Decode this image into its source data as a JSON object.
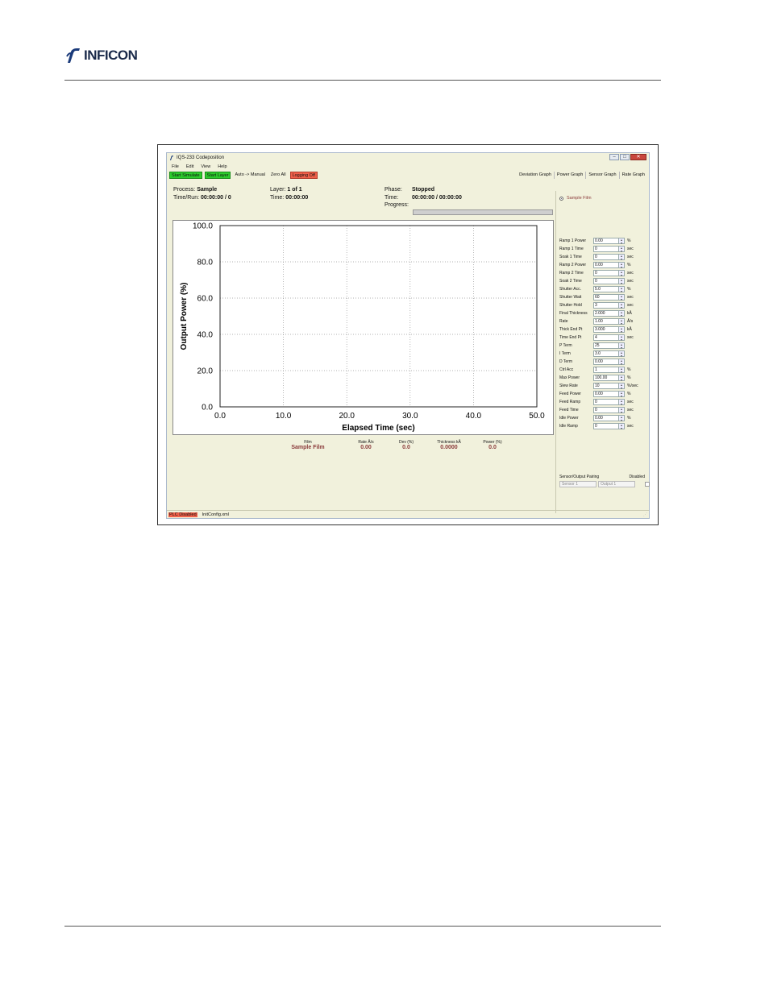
{
  "page": {
    "brand": "INFICON"
  },
  "window": {
    "title": "IQS-233 Codeposition",
    "controls": [
      "–",
      "□",
      "✕"
    ]
  },
  "menu": [
    "File",
    "Edit",
    "View",
    "Help"
  ],
  "toolbar": {
    "buttons": [
      {
        "label": "Start Simulate",
        "style": "green"
      },
      {
        "label": "Start Layer",
        "style": "green"
      },
      {
        "label": "Auto -> Manual",
        "style": "plain"
      },
      {
        "label": "Zero All",
        "style": "plain"
      },
      {
        "label": "Logging Off",
        "style": "red"
      }
    ],
    "graph_tabs": [
      "Deviation Graph",
      "Power Graph",
      "Sensor Graph",
      "Rate Graph"
    ]
  },
  "info": {
    "process_label": "Process:",
    "process_value": "Sample",
    "timerun_label": "Time/Run:",
    "timerun_value": "00:00:00 / 0",
    "layer_label": "Layer:",
    "layer_value": "1 of 1",
    "time_label": "Time:",
    "time_value": "00:00:00",
    "phase_label": "Phase:",
    "phase_value": "Stopped",
    "phase_time_label": "Time:",
    "phase_time_value": "00:00:00 / 00:00:00",
    "progress_label": "Progress:",
    "progress": 0
  },
  "chart_data": {
    "type": "line",
    "xlabel": "Elapsed Time (sec)",
    "ylabel": "Output Power (%)",
    "xlim": [
      0,
      50
    ],
    "ylim": [
      0,
      100
    ],
    "x_ticks": [
      "0.0",
      "10.0",
      "20.0",
      "30.0",
      "40.0",
      "50.0"
    ],
    "y_ticks": [
      "0.0",
      "20.0",
      "40.0",
      "60.0",
      "80.0",
      "100.0"
    ],
    "grid": true,
    "series": []
  },
  "stats": {
    "headers": [
      "Film",
      "Rate Å/s",
      "Dev (%)",
      "Thickness kÅ",
      "Power (%)"
    ],
    "values": [
      "Sample Film",
      "0.00",
      "0.0",
      "0.0000",
      "0.0"
    ]
  },
  "status": {
    "plc": "PLC Disabled",
    "file": "InitConfig.xml"
  },
  "right_panel": {
    "film": "Sample Film",
    "params": [
      {
        "label": "Ramp 1 Power",
        "value": "0.00",
        "unit": "%"
      },
      {
        "label": "Ramp 1 Time",
        "value": "0",
        "unit": "sec"
      },
      {
        "label": "Soak 1 Time",
        "value": "0",
        "unit": "sec"
      },
      {
        "label": "Ramp 2 Power",
        "value": "0.00",
        "unit": "%"
      },
      {
        "label": "Ramp 2 Time",
        "value": "0",
        "unit": "sec"
      },
      {
        "label": "Soak 2 Time",
        "value": "0",
        "unit": "sec"
      },
      {
        "label": "Shutter Acc.",
        "value": "5.0",
        "unit": "%"
      },
      {
        "label": "Shutter Wait",
        "value": "60",
        "unit": "sec"
      },
      {
        "label": "Shutter Hold",
        "value": "3",
        "unit": "sec"
      },
      {
        "label": "Final Thickness",
        "value": "2.000",
        "unit": "kÅ"
      },
      {
        "label": "Rate",
        "value": "1.00",
        "unit": "Å/s"
      },
      {
        "label": "Thick End Pt",
        "value": "3.000",
        "unit": "kÅ"
      },
      {
        "label": "Time End Pt",
        "value": "4",
        "unit": "sec"
      },
      {
        "label": "P Term",
        "value": "25",
        "unit": ""
      },
      {
        "label": "I Term",
        "value": "3.0",
        "unit": ""
      },
      {
        "label": "D Term",
        "value": "0.00",
        "unit": ""
      },
      {
        "label": "Ctrl Acc",
        "value": "1",
        "unit": "%"
      },
      {
        "label": "Max Power",
        "value": "100.00",
        "unit": "%"
      },
      {
        "label": "Slew Rate",
        "value": "10",
        "unit": "%/sec"
      },
      {
        "label": "Feed Power",
        "value": "0.00",
        "unit": "%"
      },
      {
        "label": "Feed Ramp",
        "value": "0",
        "unit": "sec"
      },
      {
        "label": "Feed Time",
        "value": "0",
        "unit": "sec"
      },
      {
        "label": "Idle Power",
        "value": "0.00",
        "unit": "%"
      },
      {
        "label": "Idle Ramp",
        "value": "0",
        "unit": "sec"
      }
    ],
    "pairing_label": "Sensor/Output Pairing",
    "disabled_label": "Disabled",
    "sensor_placeholder": "Sensor 1",
    "output_placeholder": "Output 1"
  }
}
